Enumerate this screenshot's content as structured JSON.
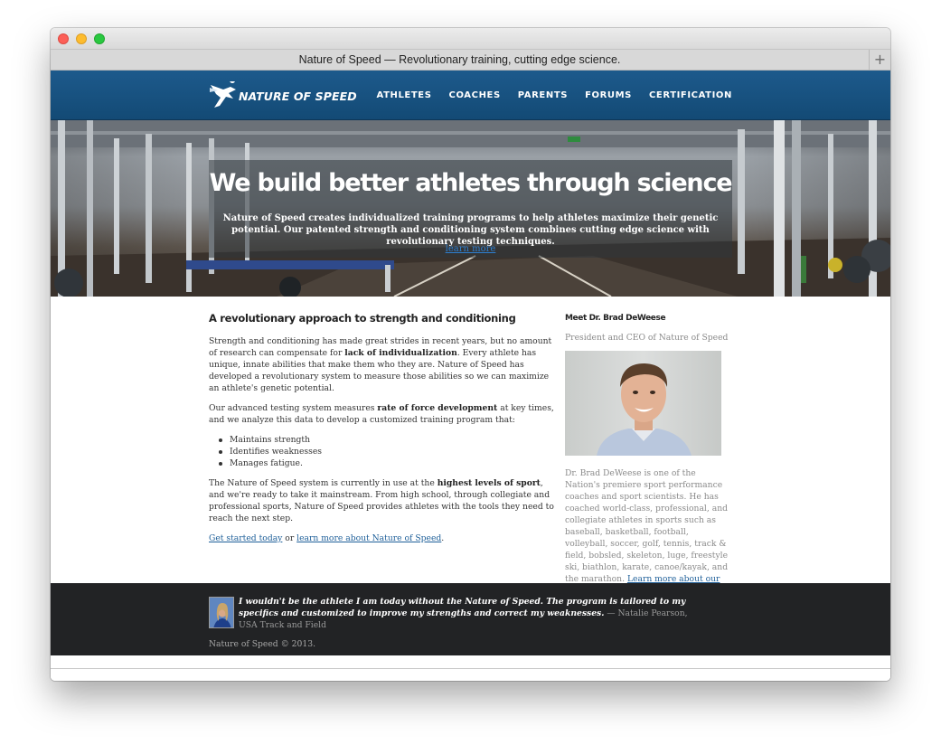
{
  "browser": {
    "tab_title": "Nature of Speed — Revolutionary training, cutting edge science.",
    "new_tab_label": "+"
  },
  "nav": {
    "logo_text": "NATURE OF SPEED",
    "links": [
      "ATHLETES",
      "COACHES",
      "PARENTS",
      "FORUMS",
      "CERTIFICATION"
    ]
  },
  "hero": {
    "title": "We build better athletes through science",
    "text": "Nature of Speed creates individualized training programs to help athletes maximize their genetic potential. Our patented strength and conditioning system combines cutting edge science with revolutionary testing techniques.",
    "link": "learn more"
  },
  "main": {
    "heading": "A revolutionary approach to strength and conditioning",
    "p1_before": "Strength and conditioning has made great strides in recent years, but no amount of research can compensate for ",
    "p1_bold": "lack of individualization",
    "p1_after": ". Every athlete has unique, innate abilities that make them who they are. Nature of Speed has developed a revolutionary system to measure those abilities so we can maximize an athlete's genetic potential.",
    "p2_before": "Our advanced testing system measures ",
    "p2_bold": "rate of force development",
    "p2_after": " at key times, and we analyze this data to develop a customized training program that:",
    "bullets": [
      "Maintains strength",
      "Identifies weaknesses",
      "Manages fatigue."
    ],
    "p3_before": "The Nature of Speed system is currently in use at the ",
    "p3_bold": "highest levels of sport",
    "p3_after": ", and we're ready to take it mainstream. From high school, through collegiate and professional sports, Nature of Speed provides athletes with the tools they need to reach the next step.",
    "cta_link1": "Get started today",
    "cta_or": " or ",
    "cta_link2": "learn more about Nature of Speed",
    "cta_end": "."
  },
  "sidebar": {
    "heading": "Meet Dr. Brad DeWeese",
    "role": "President and CEO of Nature of Speed",
    "bio": "Dr. Brad DeWeese is one of the Nation's premiere sport performance coaches and sport scientists. He has coached world-class, professional, and collegiate athletes in sports such as baseball, basketball, football, volleyball, soccer, golf, tennis, track & field, bobsled, skeleton, luge, freestyle ski, biathlon, karate, canoe/kayak, and the marathon. ",
    "bio_link": "Learn more about our staff",
    "bio_end": "."
  },
  "footer": {
    "quote": "I wouldn't be the athlete I am today without the Nature of Speed. The program is tailored to my specifics and customized to improve my strengths and correct my weaknesses.",
    "attribution": " — Natalie Pearson, USA Track and Field",
    "copyright": "Nature of Speed © 2013."
  },
  "colors": {
    "nav_bg": "#1d5a8c",
    "link": "#1e5f99",
    "footer_bg": "#222325"
  }
}
